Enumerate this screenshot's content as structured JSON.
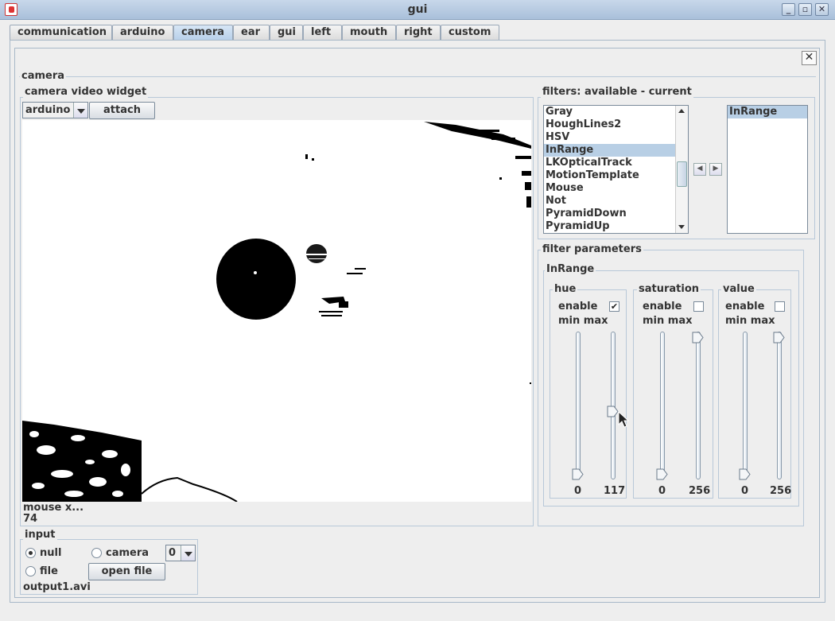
{
  "window": {
    "title": "gui"
  },
  "tabs": [
    "communication",
    "arduino",
    "camera",
    "ear",
    "gui",
    "left",
    "mouth",
    "right",
    "custom"
  ],
  "active_tab": "camera",
  "camera_panel": {
    "title": "camera",
    "video_widget_title": "camera  video widget",
    "source_select": "arduino",
    "attach_label": "attach",
    "mouse_label": "mouse x...",
    "mouse_value": "74"
  },
  "filters": {
    "title": "filters: available - current",
    "available": [
      "Gray",
      "HoughLines2",
      "HSV",
      "InRange",
      "LKOpticalTrack",
      "MotionTemplate",
      "Mouse",
      "Not",
      "PyramidDown",
      "PyramidUp"
    ],
    "selected_available": "InRange",
    "current": [
      "InRange"
    ],
    "move_left_icon": "arrow-left-icon",
    "move_right_icon": "arrow-right-icon"
  },
  "params": {
    "title": "filter parameters",
    "filter_name": "InRange",
    "groups": [
      {
        "name": "hue",
        "enable_label": "enable",
        "enabled": true,
        "minmax_label": "min max",
        "min": 0,
        "max": 117,
        "min_display": "0",
        "max_display": "117",
        "max_range": 256
      },
      {
        "name": "saturation",
        "enable_label": "enable",
        "enabled": false,
        "minmax_label": "min max",
        "min": 0,
        "max": 256,
        "min_display": "0",
        "max_display": "256",
        "max_range": 256
      },
      {
        "name": "value",
        "enable_label": "enable",
        "enabled": false,
        "minmax_label": "min max",
        "min": 0,
        "max": 256,
        "min_display": "0",
        "max_display": "256",
        "max_range": 256
      }
    ]
  },
  "input": {
    "title": "input",
    "null_label": "null",
    "camera_label": "camera",
    "camera_index": "0",
    "file_label": "file",
    "open_file_label": "open file",
    "filename": "output1.avi",
    "selected": "null"
  },
  "colors": {
    "titlebar": "#b4c8de",
    "selection": "#b8cfe5",
    "video_bg": "#ffffff",
    "blob": "#000000"
  }
}
